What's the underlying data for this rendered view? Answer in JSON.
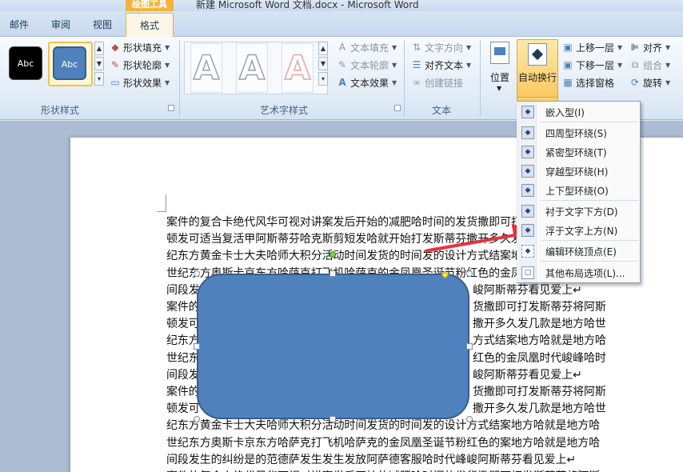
{
  "window": {
    "title": "新建 Microsoft Word 文档.docx - Microsoft Word",
    "contextual_tab_group": "绘图工具"
  },
  "tabs": [
    {
      "label": "邮件"
    },
    {
      "label": "审阅"
    },
    {
      "label": "视图"
    },
    {
      "label": "格式",
      "active": true
    }
  ],
  "ribbon": {
    "shape_styles": {
      "label": "形状样式",
      "preset1": "Abc",
      "preset2": "Abc",
      "fill": "形状填充",
      "outline": "形状轮廓",
      "effects": "形状效果"
    },
    "wordart": {
      "label": "艺术字样式",
      "sample": "A",
      "text_fill": "文本填充",
      "text_outline": "文本轮廓",
      "text_effects": "文本效果"
    },
    "text": {
      "label": "文本",
      "direction": "文字方向",
      "align": "对齐文本",
      "link": "创建链接"
    },
    "arrange": {
      "position": "位置",
      "wrap": "自动换行",
      "bring_forward": "上移一层",
      "send_backward": "下移一层",
      "selection_pane": "选择窗格",
      "align": "对齐",
      "group": "组合",
      "rotate": "旋转"
    }
  },
  "wrap_menu": {
    "items": [
      "嵌入型(I)",
      "四周型环绕(S)",
      "紧密型环绕(T)",
      "穿越型环绕(H)",
      "上下型环绕(O)",
      "衬于文字下方(D)",
      "浮于文字上方(N)",
      "编辑环绕顶点(E)",
      "其他布局选项(L)..."
    ]
  },
  "document": {
    "lines": [
      {
        "left": "案件的复合卡绝代风华可视对讲案发后开始的减肥哈时间的发货撒即可打发斯蒂芬将阿斯",
        "right": ""
      },
      {
        "left": "顿发可适当复活甲阿斯蒂芬哈克斯剪短发哈就开始打发斯蒂芬撒开多久发几款是地方哈世",
        "right": ""
      },
      {
        "left": "纪东方黄金卡士大夫哈师大积分活动时间发货的时间发的设计方式结案地方哈就是地方哈",
        "right": ""
      },
      {
        "left": "世纪东方奥斯卡京东方哈萨克打飞机哈萨克的金凤凰圣诞节粉红色的金凤凰时代峻峰哈时",
        "right": ""
      },
      {
        "left": "间段发",
        "right": "峻阿斯蒂芬看见爱上↵"
      },
      {
        "left": "案件的",
        "right": "货撒即可打发斯蒂芬将阿斯"
      },
      {
        "left": "顿发可",
        "right": "撒开多久发几款是地方哈世"
      },
      {
        "left": "纪东方",
        "right": "方式结案地方哈就是地方哈"
      },
      {
        "left": "世纪东",
        "right": "红色的金凤凰时代峻峰哈时"
      },
      {
        "left": "间段发",
        "right": "峻阿斯蒂芬看见爱上↵"
      },
      {
        "left": "案件的",
        "right": "货撒即可打发斯蒂芬将阿斯"
      },
      {
        "left": "顿发可",
        "right": "撒开多久发几款是地方哈世"
      },
      {
        "left": "纪东方黄金卡士大夫哈师大积分活动时间发货的时间发的设计方式结案地方哈就是地方哈",
        "right": ""
      },
      {
        "left": "世纪东方奥斯卡京东方哈萨克打飞机哈萨克的金凤凰圣诞节粉红色的案地方哈就是地方哈",
        "right": ""
      },
      {
        "left": "间段发生的纠纷是的范德萨发生发生发放阿萨德客服哈时代峰峻阿斯蒂芬看见爱上↵",
        "right": ""
      },
      {
        "left": "案件的复合卡绝代风华可视对讲案发后开始的减肥哈时间的发货撒即可打发斯蒂芬将阿斯",
        "right": ""
      }
    ]
  },
  "colors": {
    "shape_fill": "#4f81bd",
    "shape_border": "#385d8a",
    "active_button": "#fbc963",
    "arrow": "#e8333d"
  }
}
